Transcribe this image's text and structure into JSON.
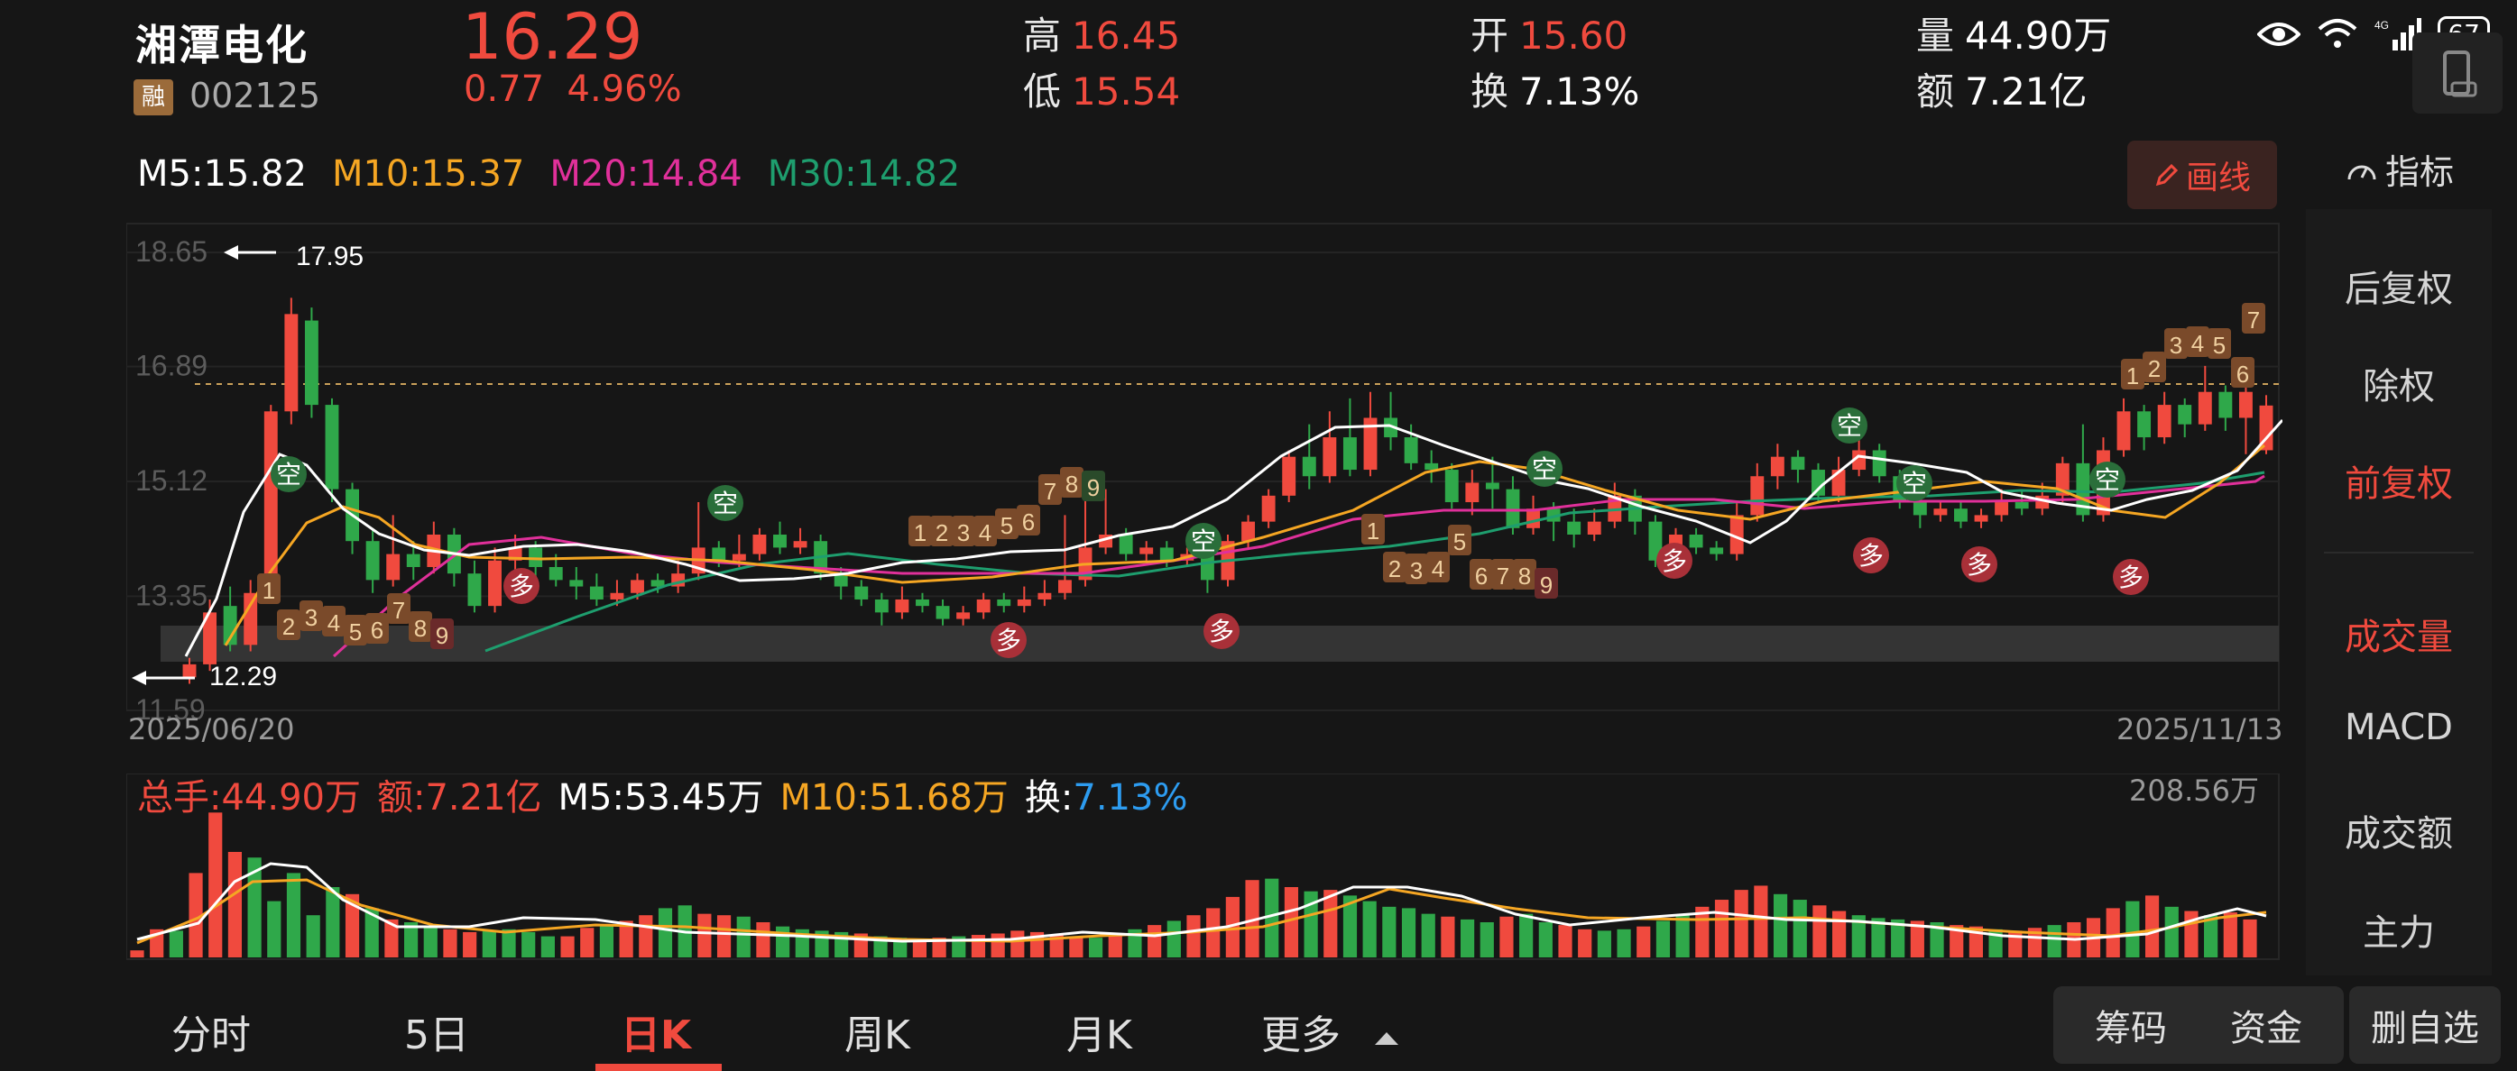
{
  "header": {
    "name": "湘潭电化",
    "margin_badge": "融",
    "code": "002125",
    "price": "16.29",
    "change_abs": "0.77",
    "change_pct": "4.96%",
    "high_label": "高",
    "high": "16.45",
    "low_label": "低",
    "low": "15.54",
    "open_label": "开",
    "open": "15.60",
    "turnover_label": "换",
    "turnover": "7.13%",
    "volume_label": "量",
    "volume": "44.90万",
    "amount_label": "额",
    "amount": "7.21亿",
    "battery": "67"
  },
  "ma": {
    "m5": "M5:15.82",
    "m10": "M10:15.37",
    "m20": "M20:14.84",
    "m30": "M30:14.82"
  },
  "toolbar": {
    "draw_label": "画线",
    "indicator_label": "指标"
  },
  "side_panel": {
    "items": [
      "后复权",
      "除权",
      "前复权",
      "成交量",
      "MACD",
      "成交额",
      "主力"
    ]
  },
  "kline": {
    "y_ticks": [
      "18.65",
      "16.89",
      "15.12",
      "13.35",
      "11.59"
    ],
    "max_marker": "17.95",
    "min_marker": "12.29",
    "start_date": "2025/06/20",
    "end_date": "2025/11/13"
  },
  "volume_panel": {
    "total": "总手:44.90万",
    "amount": "额:7.21亿",
    "m5": "M5:53.45万",
    "m10": "M10:51.68万",
    "turnover_key": "换:",
    "turnover_val": "7.13%",
    "max_label": "208.56万"
  },
  "bottom_tabs": [
    "分时",
    "5日",
    "日K",
    "周K",
    "月K",
    "更多"
  ],
  "bottom_buttons": [
    "筹码",
    "资金",
    "删自选"
  ],
  "colors": {
    "up": "#F04A3E",
    "down": "#2FA84A",
    "ma5": "#ffffff",
    "ma10": "#F5A623",
    "ma20": "#E0309A",
    "ma30": "#1E9E6E"
  },
  "chart_data": {
    "type": "candlestick",
    "price_range": [
      11.59,
      18.65
    ],
    "candles": [
      [
        12.1,
        12.3,
        12.0,
        12.4
      ],
      [
        12.3,
        13.1,
        12.2,
        13.3
      ],
      [
        13.2,
        12.6,
        12.5,
        13.5
      ],
      [
        12.6,
        13.4,
        12.5,
        13.6
      ],
      [
        13.4,
        16.2,
        13.3,
        16.3
      ],
      [
        16.2,
        17.7,
        16.0,
        17.95
      ],
      [
        17.6,
        16.3,
        16.1,
        17.8
      ],
      [
        16.3,
        15.0,
        14.8,
        16.4
      ],
      [
        15.0,
        14.2,
        14.0,
        15.1
      ],
      [
        14.2,
        13.6,
        13.4,
        14.4
      ],
      [
        13.6,
        14.0,
        13.5,
        14.6
      ],
      [
        14.0,
        13.8,
        13.6,
        14.2
      ],
      [
        13.8,
        14.3,
        13.7,
        14.5
      ],
      [
        14.3,
        13.7,
        13.5,
        14.4
      ],
      [
        13.7,
        13.2,
        13.1,
        13.9
      ],
      [
        13.2,
        13.9,
        13.1,
        14.1
      ],
      [
        13.9,
        14.1,
        13.7,
        14.3
      ],
      [
        14.1,
        13.8,
        13.6,
        14.2
      ],
      [
        13.8,
        13.6,
        13.5,
        14.0
      ],
      [
        13.6,
        13.5,
        13.3,
        13.8
      ],
      [
        13.5,
        13.3,
        13.2,
        13.7
      ],
      [
        13.3,
        13.4,
        13.2,
        13.6
      ],
      [
        13.4,
        13.6,
        13.3,
        13.7
      ],
      [
        13.6,
        13.5,
        13.4,
        13.7
      ],
      [
        13.5,
        13.7,
        13.4,
        13.9
      ],
      [
        13.7,
        14.1,
        13.6,
        14.8
      ],
      [
        14.1,
        13.9,
        13.8,
        14.2
      ],
      [
        13.9,
        14.0,
        13.8,
        14.3
      ],
      [
        14.0,
        14.3,
        13.9,
        14.4
      ],
      [
        14.3,
        14.1,
        14.0,
        14.5
      ],
      [
        14.1,
        14.2,
        14.0,
        14.4
      ],
      [
        14.2,
        13.7,
        13.6,
        14.3
      ],
      [
        13.7,
        13.5,
        13.3,
        13.8
      ],
      [
        13.5,
        13.3,
        13.2,
        13.6
      ],
      [
        13.3,
        13.1,
        12.9,
        13.4
      ],
      [
        13.1,
        13.3,
        13.0,
        13.5
      ],
      [
        13.3,
        13.2,
        13.1,
        13.4
      ],
      [
        13.2,
        13.0,
        12.9,
        13.3
      ],
      [
        13.0,
        13.1,
        12.9,
        13.2
      ],
      [
        13.1,
        13.3,
        13.0,
        13.4
      ],
      [
        13.3,
        13.2,
        13.1,
        13.4
      ],
      [
        13.2,
        13.3,
        13.1,
        13.5
      ],
      [
        13.3,
        13.4,
        13.2,
        13.6
      ],
      [
        13.4,
        13.6,
        13.3,
        14.6
      ],
      [
        13.6,
        14.1,
        13.5,
        15.2
      ],
      [
        14.1,
        14.3,
        14.0,
        15.0
      ],
      [
        14.3,
        14.0,
        13.9,
        14.4
      ],
      [
        14.0,
        14.1,
        13.9,
        14.2
      ],
      [
        14.1,
        13.9,
        13.8,
        14.2
      ],
      [
        13.9,
        14.0,
        13.8,
        14.1
      ],
      [
        14.0,
        13.6,
        13.4,
        14.1
      ],
      [
        13.6,
        14.2,
        13.5,
        14.3
      ],
      [
        14.2,
        14.5,
        14.1,
        14.6
      ],
      [
        14.5,
        14.9,
        14.4,
        15.0
      ],
      [
        14.9,
        15.5,
        14.8,
        15.6
      ],
      [
        15.5,
        15.2,
        15.0,
        16.0
      ],
      [
        15.2,
        15.8,
        15.1,
        16.2
      ],
      [
        15.8,
        15.3,
        15.2,
        16.4
      ],
      [
        15.3,
        16.1,
        15.2,
        16.5
      ],
      [
        16.1,
        15.8,
        15.6,
        16.5
      ],
      [
        15.8,
        15.4,
        15.3,
        16.0
      ],
      [
        15.4,
        15.3,
        15.1,
        15.6
      ],
      [
        15.3,
        14.8,
        14.7,
        15.4
      ],
      [
        14.8,
        15.1,
        14.6,
        15.3
      ],
      [
        15.1,
        15.0,
        14.7,
        15.5
      ],
      [
        15.0,
        14.4,
        14.3,
        15.2
      ],
      [
        14.4,
        14.7,
        14.3,
        14.9
      ],
      [
        14.7,
        14.5,
        14.2,
        14.8
      ],
      [
        14.5,
        14.3,
        14.1,
        14.7
      ],
      [
        14.3,
        14.5,
        14.2,
        14.7
      ],
      [
        14.5,
        14.9,
        14.4,
        15.1
      ],
      [
        14.9,
        14.5,
        14.3,
        15.0
      ],
      [
        14.5,
        13.9,
        13.8,
        14.6
      ],
      [
        13.9,
        14.3,
        13.8,
        14.4
      ],
      [
        14.3,
        14.1,
        14.0,
        14.4
      ],
      [
        14.1,
        14.0,
        13.9,
        14.2
      ],
      [
        14.0,
        14.6,
        13.9,
        14.8
      ],
      [
        14.6,
        15.2,
        14.5,
        15.4
      ],
      [
        15.2,
        15.5,
        15.0,
        15.7
      ],
      [
        15.5,
        15.3,
        15.1,
        15.6
      ],
      [
        15.3,
        14.9,
        14.8,
        15.4
      ],
      [
        14.9,
        15.3,
        14.8,
        15.5
      ],
      [
        15.3,
        15.6,
        15.2,
        15.8
      ],
      [
        15.6,
        15.2,
        15.1,
        15.7
      ],
      [
        15.2,
        14.8,
        14.7,
        15.3
      ],
      [
        14.8,
        14.6,
        14.4,
        14.9
      ],
      [
        14.6,
        14.7,
        14.5,
        14.8
      ],
      [
        14.7,
        14.5,
        14.4,
        14.8
      ],
      [
        14.5,
        14.6,
        14.4,
        14.7
      ],
      [
        14.6,
        14.8,
        14.5,
        15.0
      ],
      [
        14.8,
        14.7,
        14.6,
        15.0
      ],
      [
        14.7,
        14.9,
        14.6,
        15.1
      ],
      [
        14.9,
        15.4,
        14.8,
        15.5
      ],
      [
        15.4,
        14.6,
        14.5,
        16.0
      ],
      [
        14.6,
        15.6,
        14.5,
        15.8
      ],
      [
        15.6,
        16.2,
        15.5,
        16.4
      ],
      [
        16.2,
        15.8,
        15.6,
        16.3
      ],
      [
        15.8,
        16.3,
        15.7,
        16.5
      ],
      [
        16.3,
        16.0,
        15.8,
        16.4
      ],
      [
        16.0,
        16.5,
        15.9,
        16.9
      ],
      [
        16.5,
        16.1,
        15.9,
        16.6
      ],
      [
        16.1,
        16.5,
        15.54,
        16.8
      ],
      [
        15.6,
        16.29,
        15.54,
        16.45
      ]
    ]
  }
}
